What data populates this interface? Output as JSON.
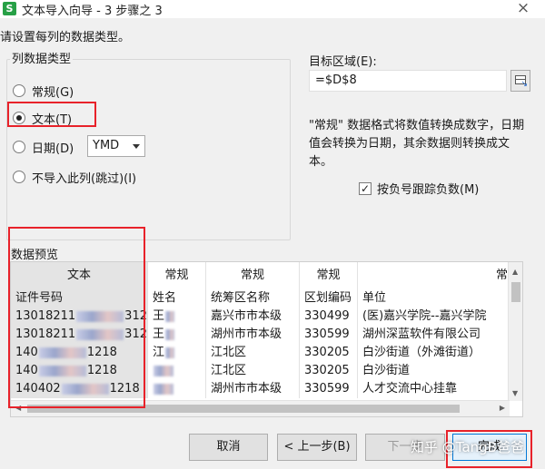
{
  "title": "文本导入向导 - 3 步骤之 3",
  "app_icon": "S",
  "instruction": "请设置每列的数据类型。",
  "column_type": {
    "group_title": "列数据类型",
    "options": [
      "常规(G)",
      "文本(T)",
      "日期(D)",
      "不导入此列(跳过)(I)"
    ],
    "selected": "文本(T)",
    "date_format": "YMD"
  },
  "target": {
    "label": "目标区域(E):",
    "value": "=$D$8"
  },
  "description": "\"常规\" 数据格式将数值转换成数字，日期值会转换为日期，其余数据则转换成文本。",
  "negative_numbers": {
    "label": "按负号跟踪负数(M)",
    "checked": true
  },
  "preview": {
    "title": "数据预览",
    "columns": [
      {
        "header": "文本",
        "cells": [
          "证件号码",
          "13018211",
          "13018211",
          "140",
          "140",
          "140402"
        ],
        "cell_suffix": [
          "",
          "312",
          "312",
          "1218",
          "1218",
          "1218"
        ]
      },
      {
        "header": "常规",
        "cells": [
          "姓名",
          "王",
          "王",
          "江",
          "",
          ""
        ]
      },
      {
        "header": "常规",
        "cells": [
          "统筹区名称",
          "嘉兴市市本级",
          "湖州市市本级",
          "江北区",
          "江北区",
          "湖州市市本级"
        ]
      },
      {
        "header": "常规",
        "cells": [
          "区划编码",
          "330499",
          "330599",
          "330205",
          "330205",
          "330599"
        ]
      },
      {
        "header": "常",
        "cells": [
          "单位",
          "(医)嘉兴学院--嘉兴学院",
          "湖州深蓝软件有限公司",
          "白沙街道（外滩街道）",
          "白沙街道",
          "人才交流中心挂靠"
        ]
      }
    ]
  },
  "buttons": {
    "cancel": "取消",
    "back": "< 上一步(B)",
    "next": "下一步",
    "finish": "完成"
  },
  "watermark": "知乎 @TangB爸爸",
  "highlight_color": "#e8222a"
}
